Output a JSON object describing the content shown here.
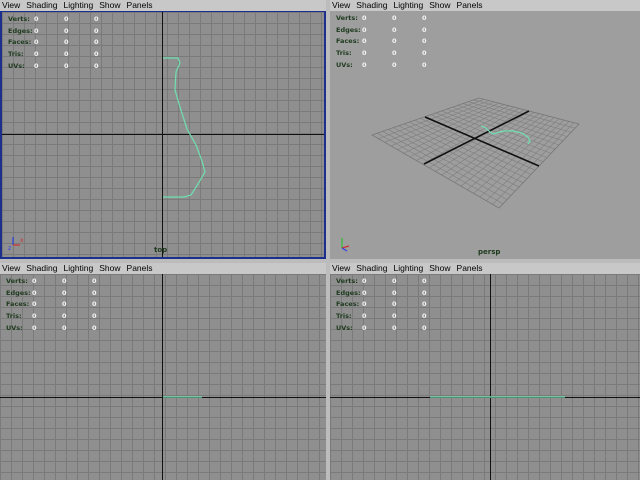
{
  "menu": [
    "View",
    "Shading",
    "Lighting",
    "Show",
    "Panels"
  ],
  "hud": {
    "labels": [
      "Verts:",
      "Edges:",
      "Faces:",
      "Tris:",
      "UVs:"
    ],
    "values": [
      "0",
      "0",
      "0"
    ]
  },
  "viewports": {
    "top": {
      "camera": "top"
    },
    "persp": {
      "camera": "persp"
    },
    "front": {
      "camera": ""
    },
    "side": {
      "camera": ""
    }
  },
  "colors": {
    "curve": "#6fe0b0",
    "active_border": "#1c2f8c",
    "hud_label": "#1e3a1e",
    "axis_x": "#d03030",
    "axis_y": "#30c030",
    "axis_z": "#3040e0"
  },
  "icons": {
    "axis_gizmo": "axis-gizmo-icon"
  }
}
